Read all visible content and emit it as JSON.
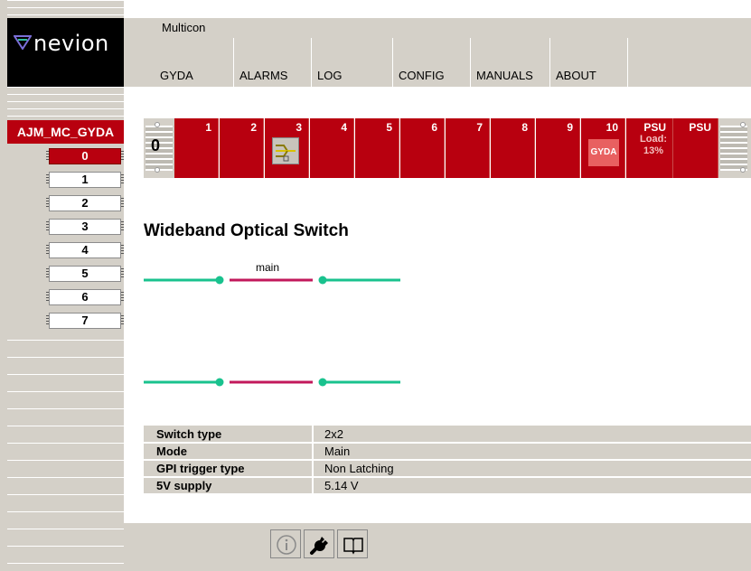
{
  "app": {
    "title": "Multicon",
    "brand": "nevion"
  },
  "menu": [
    {
      "label": "GYDA"
    },
    {
      "label": "ALARMS"
    },
    {
      "label": "LOG"
    },
    {
      "label": "CONFIG"
    },
    {
      "label": "MANUALS"
    },
    {
      "label": "ABOUT"
    }
  ],
  "sidebar": {
    "device_name": "AJM_MC_GYDA",
    "frames": [
      "0",
      "1",
      "2",
      "3",
      "4",
      "5",
      "6",
      "7"
    ],
    "active_frame": "0"
  },
  "slotbar": {
    "frame_number": "0",
    "slots": [
      {
        "label": "1"
      },
      {
        "label": "2"
      },
      {
        "label": "3",
        "icon": "optical-switch-icon"
      },
      {
        "label": "4"
      },
      {
        "label": "5"
      },
      {
        "label": "6"
      },
      {
        "label": "7"
      },
      {
        "label": "8"
      },
      {
        "label": "9"
      },
      {
        "label": "10",
        "badge": "GYDA"
      },
      {
        "label": "PSU",
        "load_label": "Load:",
        "load_value": "13%"
      },
      {
        "label": "PSU"
      }
    ]
  },
  "module": {
    "title": "Wideband Optical Switch",
    "path_label": "main"
  },
  "info": {
    "rows": [
      {
        "label": "Switch type",
        "value": "2x2"
      },
      {
        "label": "Mode",
        "value": "Main"
      },
      {
        "label": "GPI trigger type",
        "value": "Non Latching"
      },
      {
        "label": "5V supply",
        "value": "5.14 V"
      }
    ]
  },
  "toolbar": {
    "icons": [
      "info-icon",
      "wrench-icon",
      "book-icon"
    ]
  },
  "colors": {
    "accent": "#b8000f",
    "panel": "#d4d0c8",
    "line_green": "#19c28e",
    "line_red": "#c2185b"
  }
}
